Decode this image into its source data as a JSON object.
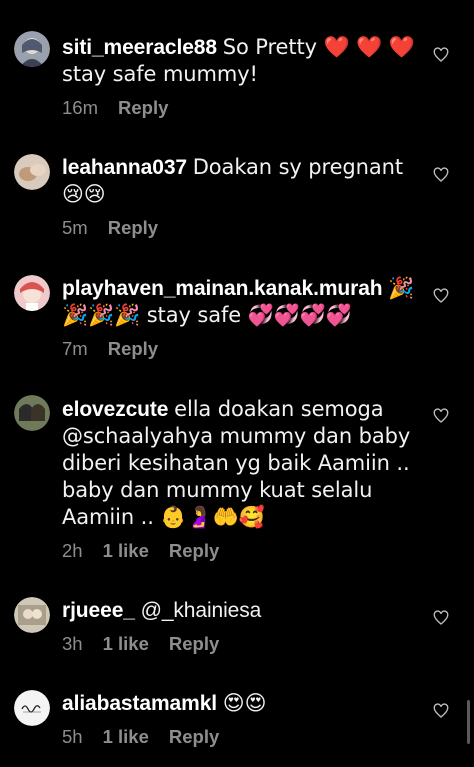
{
  "comments": [
    {
      "username": "siti_meeracle88",
      "text": "So Pretty ❤️ ❤️ ❤️ stay safe mummy!",
      "time": "16m",
      "likes": "",
      "reply": "Reply",
      "avatar_color": "#8a8d99"
    },
    {
      "username": "leahanna037",
      "text": "Doakan sy pregnant 😢😢",
      "time": "5m",
      "likes": "",
      "reply": "Reply",
      "avatar_color": "#c9b8a6"
    },
    {
      "username": "playhaven_mainan.kanak.murah",
      "text": "🎉🎉🎉🎉 stay safe 💞💞💞💞",
      "time": "7m",
      "likes": "",
      "reply": "Reply",
      "avatar_color": "#e6a3a8"
    },
    {
      "username": "elovezcute",
      "text": "ella doakan semoga @schaalyahya mummy dan baby diberi kesihatan yg baik Aamiin .. baby dan mummy kuat selalu Aamiin .. 👶🤰🤲🥰",
      "time": "2h",
      "likes": "1 like",
      "reply": "Reply",
      "avatar_color": "#4e5a3e"
    },
    {
      "username": "rjueee_",
      "text": "@_khainiesa",
      "time": "3h",
      "likes": "1 like",
      "reply": "Reply",
      "avatar_color": "#b9b3a4"
    },
    {
      "username": "aliabastamamkl",
      "text": "😍😍",
      "time": "5h",
      "likes": "1 like",
      "reply": "Reply",
      "avatar_color": "#f4f4f4"
    }
  ],
  "colors": {
    "background": "#000000",
    "text": "#f2f2f2",
    "secondary": "#8e8e8e"
  },
  "icons": {
    "like": "heart-outline-icon"
  }
}
